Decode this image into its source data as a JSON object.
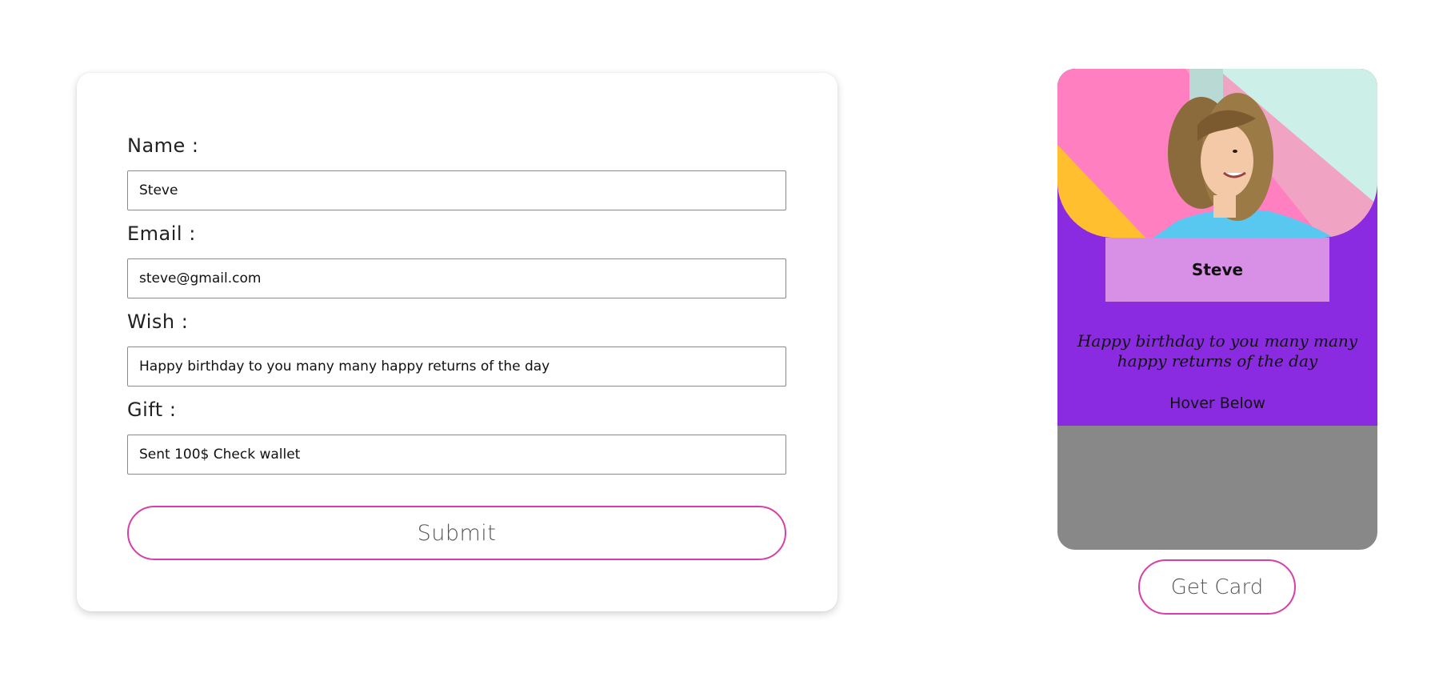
{
  "form": {
    "fields": [
      {
        "label": "Name :",
        "value": "Steve"
      },
      {
        "label": "Email :",
        "value": "steve@gmail.com"
      },
      {
        "label": "Wish :",
        "value": "Happy birthday to you many many happy returns of the day"
      },
      {
        "label": "Gift :",
        "value": "Sent 100$ Check wallet"
      }
    ],
    "submit_label": "Submit"
  },
  "card": {
    "name": "Steve",
    "wish": "Happy birthday to you many many happy returns of the day",
    "hover_text": "Hover Below",
    "get_card_label": "Get Card"
  },
  "colors": {
    "accent_border": "#d63fa8",
    "card_purple": "#8a2be2",
    "name_badge": "#d890e6",
    "card_bottom_gray": "#888888"
  }
}
